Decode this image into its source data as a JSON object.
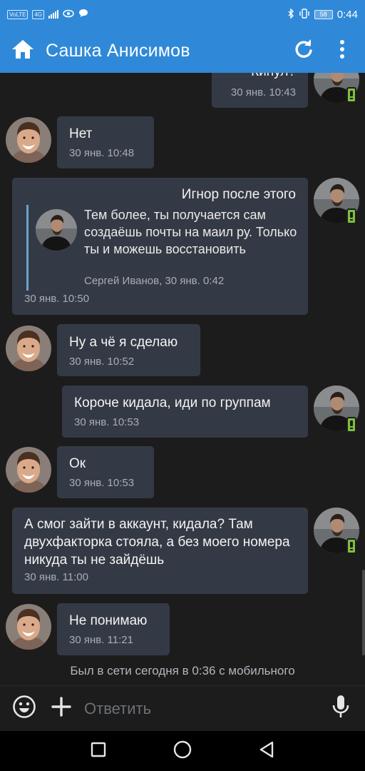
{
  "status_bar": {
    "volte_label": "VoLTE",
    "network_label": "4G",
    "battery_level": "58",
    "time": "0:44"
  },
  "header": {
    "title": "Сашка Анисимов"
  },
  "messages": [
    {
      "side": "out",
      "text": "Кинул?",
      "time": "30 янв. 10:43"
    },
    {
      "side": "in",
      "text": "Нет",
      "time": "30 янв. 10:48"
    },
    {
      "side": "out",
      "text": "Игнор после этого",
      "time": "30 янв. 10:50",
      "quote": {
        "text": "Тем более, ты получается сам создаёшь почты на маил ру. Только ты и можешь восстановить",
        "author_time": "Сергей Иванов, 30 янв. 0:42"
      }
    },
    {
      "side": "in",
      "text": "Ну а чё я сделаю",
      "time": "30 янв. 10:52"
    },
    {
      "side": "out",
      "text": "Короче кидала, иди по группам",
      "time": "30 янв. 10:53"
    },
    {
      "side": "in",
      "text": "Ок",
      "time": "30 янв. 10:53"
    },
    {
      "side": "out",
      "text": "А смог зайти в аккаунт, кидала? Там двухфакторка стояла, а без моего номера никуда ты не зайдёшь",
      "time": "30 янв. 11:00"
    },
    {
      "side": "in",
      "text": "Не понимаю",
      "time": "30 янв. 11:21"
    }
  ],
  "online_status": "Был в сети сегодня в 0:36 с мобильного",
  "composer": {
    "placeholder": "Ответить"
  },
  "colors": {
    "accent": "#2f89d8",
    "background": "#1c1c1c",
    "bubble": "#343a45",
    "mobile_badge": "#7fbf3d"
  },
  "icons": [
    "home-icon",
    "refresh-icon",
    "more-vert-icon",
    "emoji-icon",
    "plus-icon",
    "mic-icon",
    "nav-square-icon",
    "nav-circle-icon",
    "nav-back-icon"
  ]
}
